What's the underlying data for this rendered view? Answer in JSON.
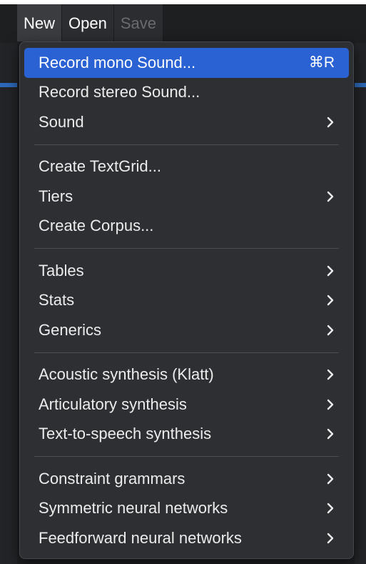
{
  "menubar": {
    "items": [
      {
        "label": "New"
      },
      {
        "label": "Open"
      },
      {
        "label": "Save"
      }
    ]
  },
  "menu": {
    "groups": [
      {
        "items": [
          {
            "label": "Record mono Sound...",
            "shortcut": "⌘R"
          },
          {
            "label": "Record stereo Sound..."
          },
          {
            "label": "Sound",
            "submenu": true
          }
        ]
      },
      {
        "items": [
          {
            "label": "Create TextGrid..."
          },
          {
            "label": "Tiers",
            "submenu": true
          },
          {
            "label": "Create Corpus..."
          }
        ]
      },
      {
        "items": [
          {
            "label": "Tables",
            "submenu": true
          },
          {
            "label": "Stats",
            "submenu": true
          },
          {
            "label": "Generics",
            "submenu": true
          }
        ]
      },
      {
        "items": [
          {
            "label": "Acoustic synthesis (Klatt)",
            "submenu": true
          },
          {
            "label": "Articulatory synthesis",
            "submenu": true
          },
          {
            "label": "Text-to-speech synthesis",
            "submenu": true
          }
        ]
      },
      {
        "items": [
          {
            "label": "Constraint grammars",
            "submenu": true
          },
          {
            "label": "Symmetric neural networks",
            "submenu": true
          },
          {
            "label": "Feedforward neural networks",
            "submenu": true
          }
        ]
      }
    ]
  },
  "colors": {
    "highlight": "#2a62d4",
    "menu_bg": "#2e2f33",
    "text": "#ececec",
    "disabled_text": "#6a6b70"
  },
  "icons": {
    "submenu": "chevron-right-icon"
  }
}
